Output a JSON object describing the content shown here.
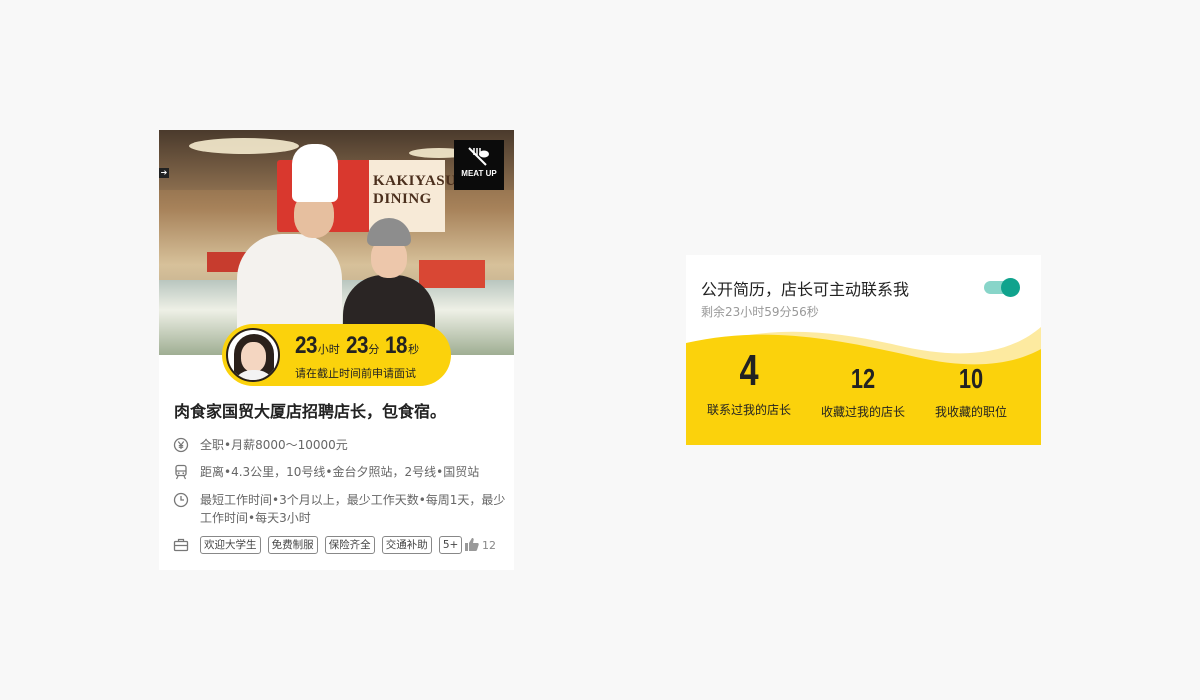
{
  "job_card": {
    "photo_sign_text": "KAKIYASU DINING",
    "logo_text": "MEAT UP",
    "countdown": {
      "hours": "23",
      "hours_unit": "小时",
      "minutes": "23",
      "minutes_unit": "分",
      "seconds": "18",
      "seconds_unit": "秒",
      "caption": "请在截止时间前申请面试"
    },
    "title": "肉食家国贸大厦店招聘店长，包食宿。",
    "salary_icon": "yen-icon",
    "salary": "全职•月薪8000～10000元",
    "distance_icon": "train-icon",
    "distance": "距离•4.3公里，10号线•金台夕照站，2号线•国贸站",
    "schedule_icon": "clock-icon",
    "schedule": "最短工作时间•3个月以上，最少工作天数•每周1天，最少工作时间•每天3小时",
    "benefits_icon": "briefcase-icon",
    "tags": [
      "欢迎大学生",
      "免费制服",
      "保险齐全",
      "交通补助",
      "5+"
    ],
    "likes_icon": "thumbs-up-icon",
    "likes": "12"
  },
  "resume_card": {
    "title": "公开简历，店长可主动联系我",
    "toggle_on": true,
    "countdown_text": "剩余23小时59分56秒",
    "stats": [
      {
        "value": "4",
        "label": "联系过我的店长"
      },
      {
        "value": "12",
        "label": "收藏过我的店长"
      },
      {
        "value": "10",
        "label": "我收藏的职位"
      }
    ],
    "accent_color": "#fbd20c",
    "toggle_color": "#10a38d"
  }
}
